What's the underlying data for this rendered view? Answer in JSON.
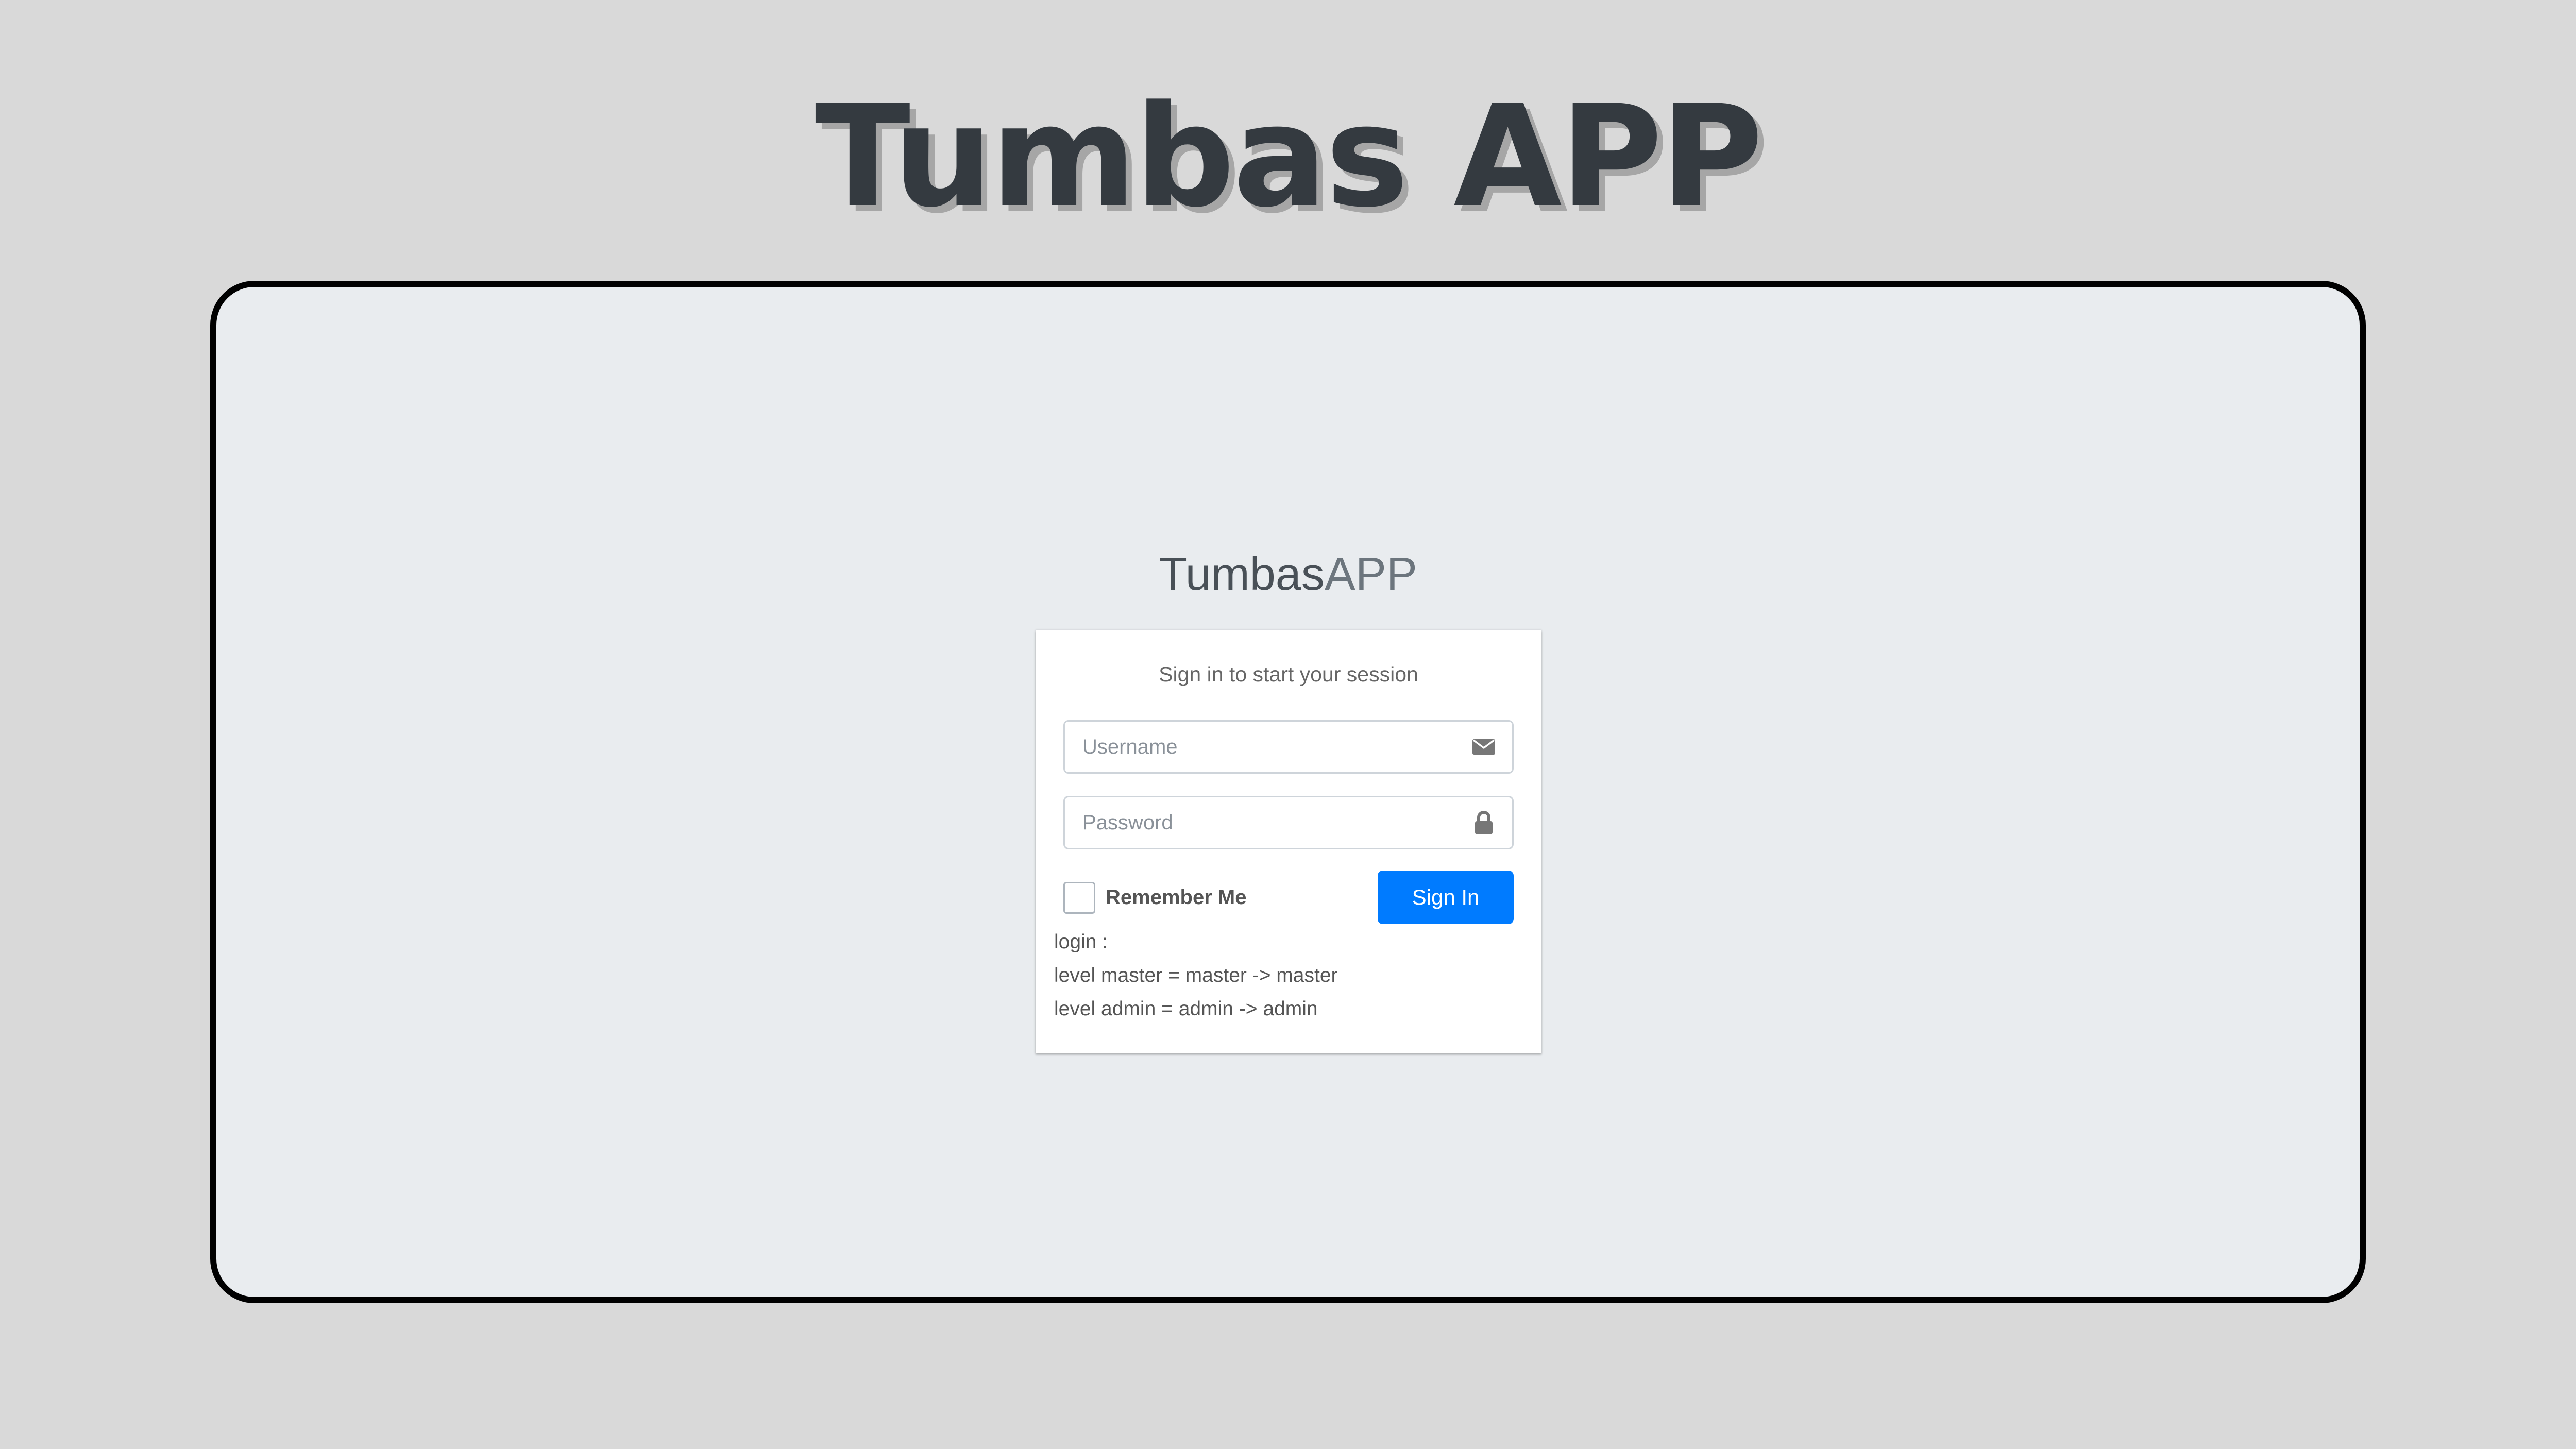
{
  "page": {
    "title": "Tumbas APP"
  },
  "brand": {
    "bold": "Tumbas",
    "light": "APP"
  },
  "login": {
    "message": "Sign in to start your session",
    "username_placeholder": "Username",
    "username_icon": "envelope-icon",
    "password_placeholder": "Password",
    "password_icon": "lock-icon",
    "remember_label": "Remember Me",
    "remember_checked": false,
    "signin_label": "Sign In"
  },
  "hints": [
    "login :",
    "level master = master -> master",
    "level admin = admin -> admin"
  ],
  "colors": {
    "page_background": "#d9d9d9",
    "frame_background": "#e9ecef",
    "primary_button": "#007bff",
    "title": "#343a40"
  }
}
